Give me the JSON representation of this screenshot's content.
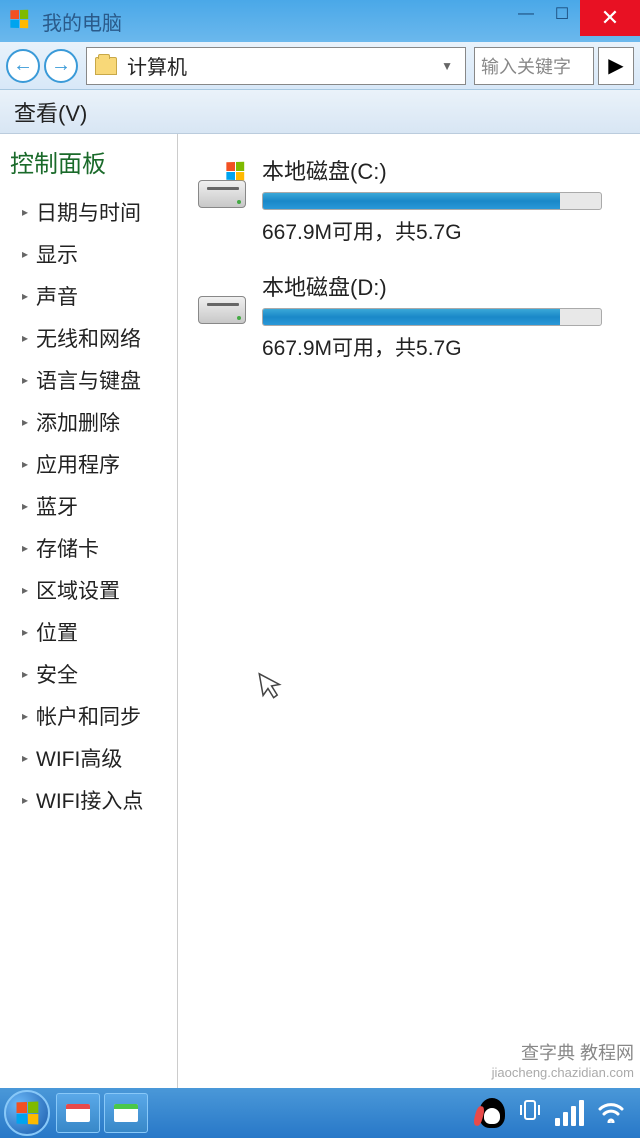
{
  "window": {
    "title": "我的电脑"
  },
  "toolbar": {
    "address": "计算机",
    "search_placeholder": "输入关键字"
  },
  "menubar": {
    "view": "查看(V)"
  },
  "sidebar": {
    "title": "控制面板",
    "items": [
      {
        "label": "日期与时间"
      },
      {
        "label": "显示"
      },
      {
        "label": "声音"
      },
      {
        "label": "无线和网络"
      },
      {
        "label": "语言与键盘"
      },
      {
        "label": "添加删除"
      },
      {
        "label": "应用程序"
      },
      {
        "label": "蓝牙"
      },
      {
        "label": "存储卡"
      },
      {
        "label": "区域设置"
      },
      {
        "label": "位置"
      },
      {
        "label": "安全"
      },
      {
        "label": "帐户和同步"
      },
      {
        "label": "WIFI高级"
      },
      {
        "label": "WIFI接入点"
      }
    ]
  },
  "drives": [
    {
      "name": "本地磁盘(C:)",
      "status": "667.9M可用，共5.7G",
      "used_percent": 88,
      "system": true
    },
    {
      "name": "本地磁盘(D:)",
      "status": "667.9M可用，共5.7G",
      "used_percent": 88,
      "system": false
    }
  ],
  "watermark": {
    "line1": "查字典  教程网",
    "line2": "jiaocheng.chazidian.com"
  }
}
